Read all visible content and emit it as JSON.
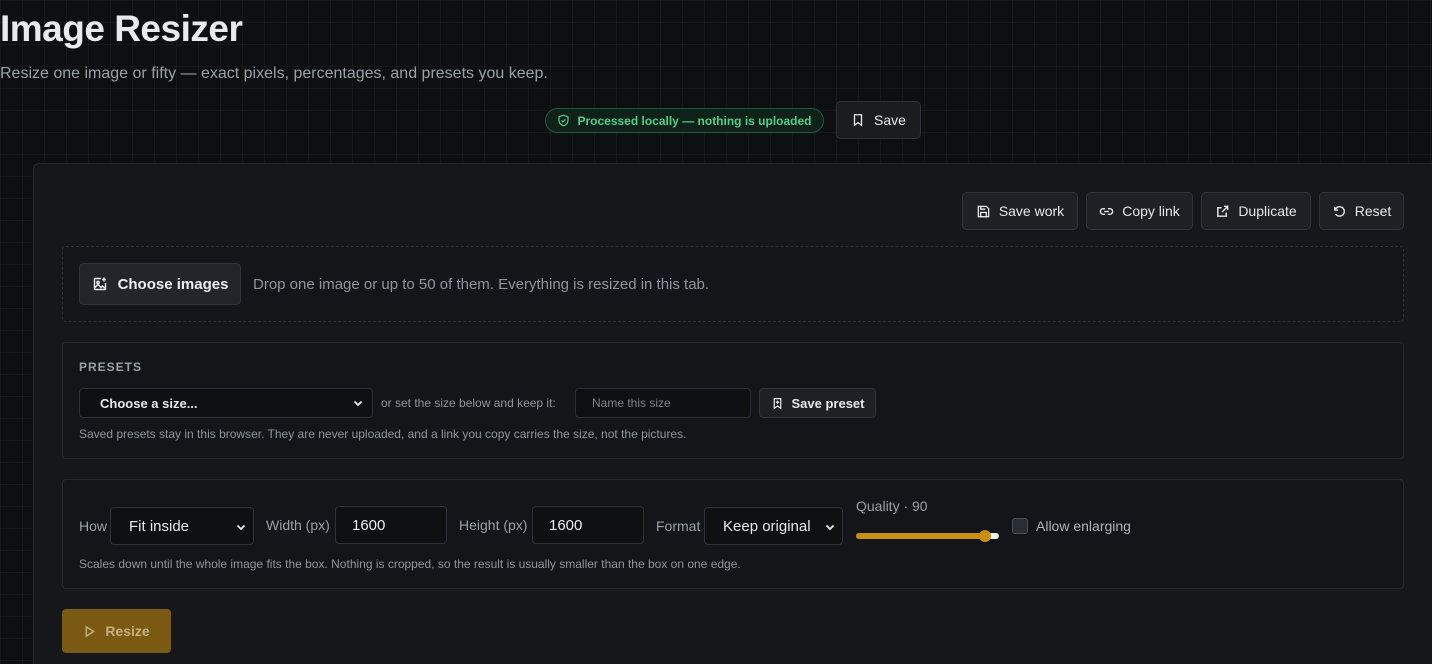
{
  "header": {
    "title": "Image Resizer",
    "subtitle": "Resize one image or fifty — exact pixels, percentages, and presets you keep.",
    "local_badge": "Processed locally — nothing is uploaded",
    "save_label": "Save"
  },
  "toolbar": {
    "save_work": "Save work",
    "copy_link": "Copy link",
    "duplicate": "Duplicate",
    "reset": "Reset"
  },
  "dropzone": {
    "choose_label": "Choose images",
    "hint": "Drop one image or up to 50 of them. Everything is resized in this tab."
  },
  "presets": {
    "heading": "PRESETS",
    "select_value": "Choose a size...",
    "inline_text": "or set the size below and keep it:",
    "name_placeholder": "Name this size",
    "save_preset_label": "Save preset",
    "note": "Saved presets stay in this browser. They are never uploaded, and a link you copy carries the size, not the pictures."
  },
  "settings": {
    "how_label": "How",
    "how_value": "Fit inside",
    "width_label": "Width (px)",
    "width_value": "1600",
    "height_label": "Height (px)",
    "height_value": "1600",
    "format_label": "Format",
    "format_value": "Keep original",
    "quality_label": "Quality · 90",
    "quality_value": 90,
    "allow_enlarging_label": "Allow enlarging",
    "allow_enlarging_checked": false,
    "note": "Scales down until the whole image fits the box. Nothing is cropped, so the result is usually smaller than the box on one edge."
  },
  "actions": {
    "resize_label": "Resize"
  },
  "colors": {
    "accent": "#c98f12",
    "badge_green": "#4ed08a",
    "background": "#0e0f11"
  }
}
